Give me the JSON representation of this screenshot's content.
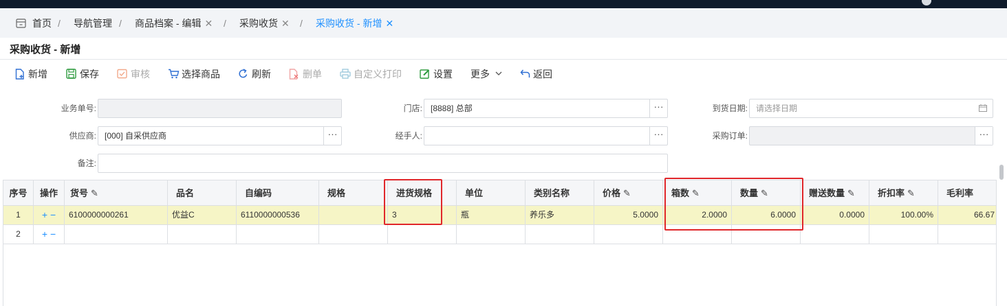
{
  "breadcrumbs": [
    {
      "label": "首页"
    },
    {
      "label": "导航管理"
    },
    {
      "label": "商品档案 - 编辑"
    },
    {
      "label": "采购收货"
    },
    {
      "label": "采购收货 - 新增"
    }
  ],
  "breadcrumb_separator": "/",
  "close_glyph": "✕",
  "page_title": "采购收货 - 新增",
  "toolbar": {
    "add": "新增",
    "save": "保存",
    "audit": "审核",
    "select_goods": "选择商品",
    "refresh": "刷新",
    "delete": "删单",
    "custom_print": "自定义打印",
    "settings": "设置",
    "more": "更多",
    "back": "返回"
  },
  "form": {
    "order_no": {
      "label": "业务单号:",
      "value": ""
    },
    "store": {
      "label": "门店:",
      "value": "[8888] 总部"
    },
    "arrival_date": {
      "label": "到货日期:",
      "placeholder": "请选择日期"
    },
    "supplier": {
      "label": "供应商:",
      "value": "[000] 自采供应商"
    },
    "handler": {
      "label": "经手人:",
      "value": ""
    },
    "purchase_order": {
      "label": "采购订单:",
      "value": ""
    },
    "remark": {
      "label": "备注:",
      "value": ""
    },
    "dots_glyph": "···"
  },
  "table": {
    "headers": {
      "seq": "序号",
      "op": "操作",
      "code": "货号",
      "name": "品名",
      "selfcode": "自编码",
      "spec": "规格",
      "inspec": "进货规格",
      "unit": "单位",
      "category": "类别名称",
      "price": "价格",
      "boxes": "箱数",
      "qty": "数量",
      "gift": "赠送数量",
      "discount": "折扣率",
      "margin": "毛利率"
    },
    "ops_plus": "+",
    "ops_minus": "−",
    "rows": [
      {
        "seq": "1",
        "code": "6100000000261",
        "name": "优益C",
        "selfcode": "6110000000536",
        "spec": "",
        "inspec": "3",
        "unit": "瓶",
        "category": "养乐多",
        "price": "5.0000",
        "boxes": "2.0000",
        "qty": "6.0000",
        "gift": "0.0000",
        "discount": "100.00%",
        "margin": "66.67"
      },
      {
        "seq": "2",
        "code": "",
        "name": "",
        "selfcode": "",
        "spec": "",
        "inspec": "",
        "unit": "",
        "category": "",
        "price": "",
        "boxes": "",
        "qty": "",
        "gift": "",
        "discount": "",
        "margin": ""
      }
    ]
  },
  "colors": {
    "accent": "#1e90ff",
    "highlight_row": "#f6f5c6",
    "annotation_red": "#e0262a"
  }
}
